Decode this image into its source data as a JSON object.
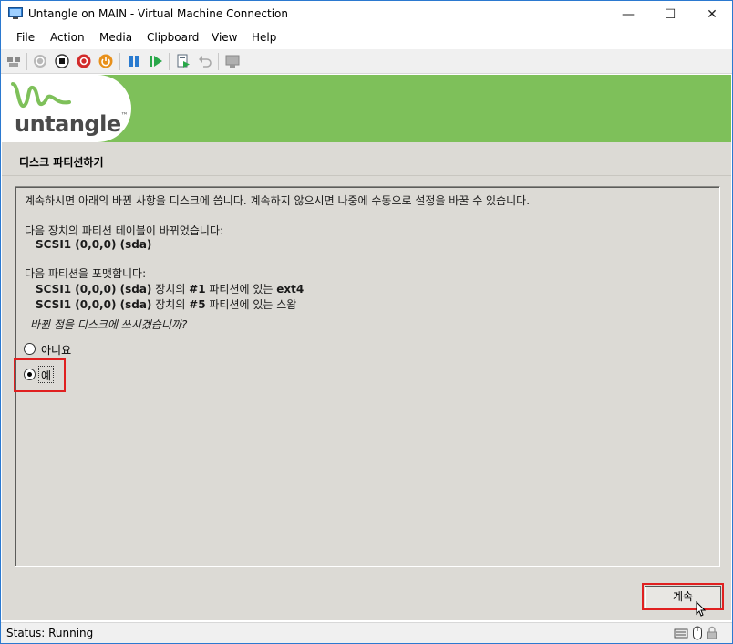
{
  "window": {
    "title": "Untangle on MAIN - Virtual Machine Connection",
    "minimize_glyph": "—",
    "maximize_glyph": "☐",
    "close_glyph": "✕",
    "icon": "vm-connection-icon"
  },
  "menu": {
    "items": [
      "File",
      "Action",
      "Media",
      "Clipboard",
      "View",
      "Help"
    ]
  },
  "toolbar": {
    "icons": [
      "ctrl-alt-del-icon",
      "start-icon",
      "turn-off-icon",
      "shutdown-icon",
      "save-icon",
      "pause-icon",
      "resume-icon",
      "checkpoint-icon",
      "revert-icon",
      "enhanced-session-icon"
    ],
    "colors": {
      "red": "#d22b2b",
      "orange": "#e8901a",
      "blue": "#2a7bd0",
      "green": "#2aa84a"
    }
  },
  "banner": {
    "logo_text": "untangle",
    "logo_tm": "™",
    "bg_color": "#7ec05a"
  },
  "installer": {
    "page_title": "디스크 파티션하기",
    "intro": "계속하시면 아래의 바뀐 사항을 디스크에 씁니다. 계속하지 않으시면 나중에 수동으로 설정을 바꿀 수 있습니다.",
    "table_changed_header": "다음 장치의 파티션 테이블이 바뀌었습니다:",
    "table_changed_device": "SCSI1 (0,0,0) (sda)",
    "format_header": "다음 파티션을 포맷합니다:",
    "format_line1_device": "SCSI1 (0,0,0) (sda)",
    "format_line1_mid": " 장치의 ",
    "format_line1_num": "#1",
    "format_line1_tail": " 파티션에 있는 ",
    "format_line1_fs": "ext4",
    "format_line2_device": "SCSI1 (0,0,0) (sda)",
    "format_line2_mid": " 장치의 ",
    "format_line2_num": "#5",
    "format_line2_tail": " 파티션에 있는 스왑",
    "question": "바뀐 점을 디스크에 쓰시겠습니까?",
    "options": [
      {
        "label": "아니요",
        "selected": false
      },
      {
        "label": "예",
        "selected": true
      }
    ],
    "continue_label": "계속"
  },
  "status": {
    "text": "Status: Running",
    "icons": [
      "keyboard-icon",
      "mouse-icon",
      "lock-icon"
    ]
  }
}
